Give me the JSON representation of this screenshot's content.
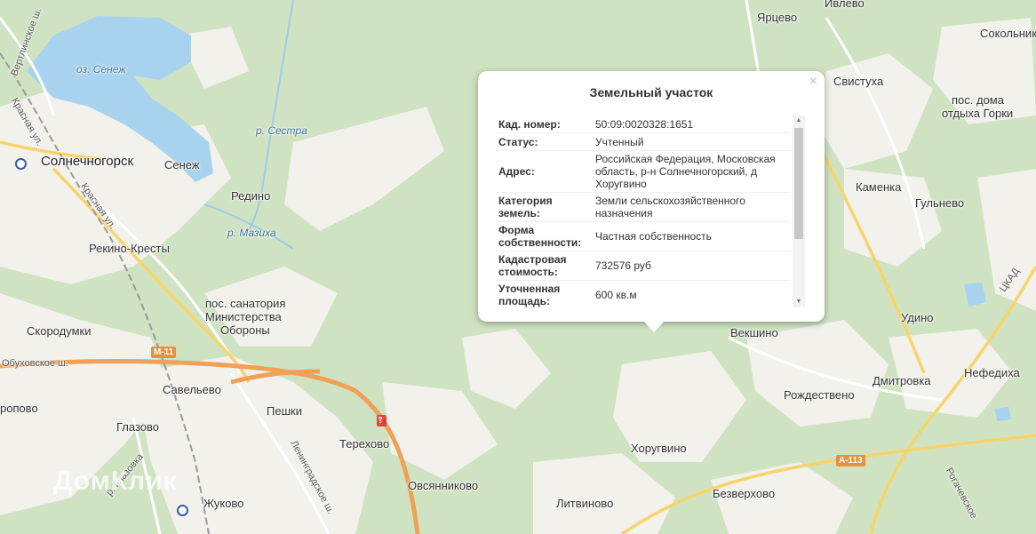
{
  "map": {
    "water_label": "оз. Сенеж",
    "rivers": [
      "р. Сестра",
      "р. Мазиха"
    ],
    "places": [
      "Солнечногорск",
      "Сенеж",
      "Редино",
      "Рекино-Кресты",
      "пос. санатория",
      "Министерства",
      "Обороны",
      "Скородумки",
      "Савельево",
      "Пешки",
      "Глазово",
      "Терехово",
      "Овсянниково",
      "Жуково",
      "Литвиново",
      "Хоругвино",
      "Безверхово",
      "Векшино",
      "Рождествено",
      "Дмитровка",
      "Нефедиха",
      "Удино",
      "Гульнево",
      "Каменка",
      "Свистуха",
      "Ярцево",
      "Ивлево",
      "Сокольники",
      "пос. дома",
      "отдыха Горки",
      "Вертлинское ш.",
      "Красная ул.",
      "Красная ул.",
      "Обуховское ш.",
      "Ленинградское ш.",
      "Рогачевское",
      "ЦКАД",
      "ропово",
      "р. Глазовка"
    ],
    "road_shields": [
      "М-11",
      "А-113"
    ],
    "watermark": "ДомКлик",
    "colors": {
      "forest": "#cfe3c2",
      "open": "#f2f1ec",
      "water": "#a8d3ef",
      "motorway": "#f0a057",
      "road": "#f7d46b"
    }
  },
  "popup": {
    "title": "Земельный участок",
    "close": "×",
    "scroll_up": "▲",
    "scroll_down": "▼",
    "rows": [
      {
        "key": "Кад. номер",
        "value": "50:09:0020328:1651"
      },
      {
        "key": "Статус",
        "value": "Учтенный"
      },
      {
        "key": "Адрес",
        "value": "Российская Федерация, Московская область, р-н Солнечногорский, д Хоругвино"
      },
      {
        "key": "Категория земель",
        "value": "Земли сельскохозяйственного назначения"
      },
      {
        "key": "Форма собственности",
        "value": "Частная собственность"
      },
      {
        "key": "Кадастровая стоимость",
        "value": "732576 руб"
      },
      {
        "key": "Уточненная площадь",
        "value": "600 кв.м"
      }
    ]
  }
}
